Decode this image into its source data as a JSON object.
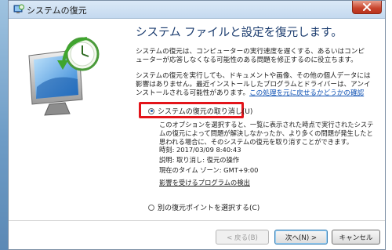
{
  "window": {
    "title": "システムの復元"
  },
  "header": {
    "heading": "システム ファイルと設定を復元します。"
  },
  "intro": {
    "para1": "システムの復元は、コンピューターの実行速度を遅くする、あるいはコンピューターが応答しなくなる可能性のある問題を修正するのに役立ちます。",
    "para2": "システムの復元を実行しても、ドキュメントや画像、その他の個人データには影響はありません。最近インストールしたプログラムとドライバーは、アンインストールされる可能性があります。",
    "link": "この処理を元に戻せるかどうかの確認"
  },
  "options": {
    "undo_label": "システムの復元の取り消し(U)",
    "undo_desc": "このオプションを選択すると、一覧に表示された時点で実行されたシステムの復元によって問題が解決しなかったか、より多くの問題が発生したと思われる場合に、そのシステムの復元を取り消すことができます。",
    "time": "時刻: 2017/03/09 8:40:43",
    "description": "説明: 取り消し: 復元の操作",
    "timezone": "現在のタイム ゾーン: GMT+9:00",
    "affected_link": "影響を受けるプログラムの検出",
    "other_label": "別の復元ポイントを選択する(C)"
  },
  "buttons": {
    "back": "< 戻る(B)",
    "next": "次へ(N) >",
    "cancel": "キャンセル"
  },
  "colors": {
    "highlight": "#e3141a",
    "link": "#0b4fb3",
    "heading": "#1a3b6e"
  }
}
